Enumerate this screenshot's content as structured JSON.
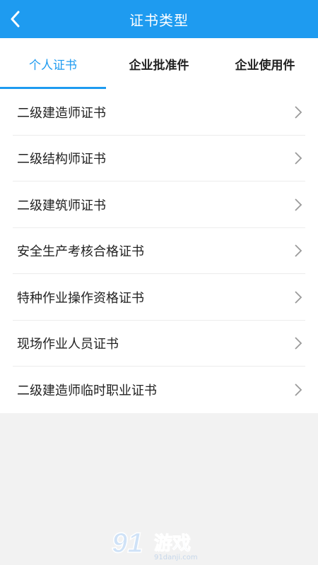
{
  "header": {
    "title": "证书类型",
    "back_icon": "chevron-left-icon"
  },
  "tabs": [
    {
      "label": "个人证书",
      "active": true
    },
    {
      "label": "企业批准件",
      "active": false
    },
    {
      "label": "企业使用件",
      "active": false
    }
  ],
  "items": [
    {
      "label": "二级建造师证书"
    },
    {
      "label": "二级结构师证书"
    },
    {
      "label": "二级建筑师证书"
    },
    {
      "label": "安全生产考核合格证书"
    },
    {
      "label": "特种作业操作资格证书"
    },
    {
      "label": "现场作业人员证书"
    },
    {
      "label": "二级建造师临时职业证书"
    }
  ],
  "colors": {
    "accent": "#1e9bf0",
    "background": "#f2f2f2",
    "text": "#222222",
    "chevron": "#9a9a9a"
  },
  "watermark": {
    "logo": "91",
    "name": "游戏",
    "url": "91danji.com"
  }
}
